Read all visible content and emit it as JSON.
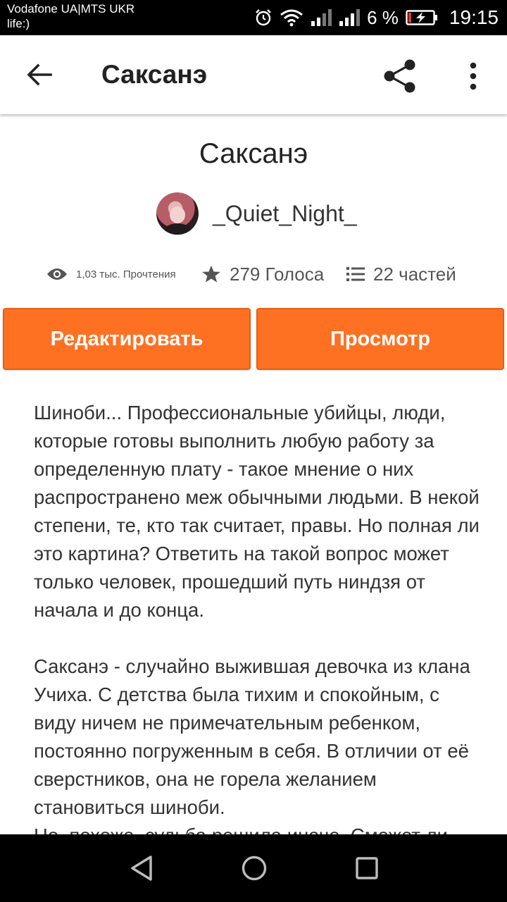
{
  "status_bar": {
    "carrier_line1": "Vodafone UA|MTS UKR",
    "carrier_line2": "life:)",
    "battery_percent": "6 %",
    "time": "19:15"
  },
  "app_bar": {
    "title": "Саксанэ",
    "icons": [
      "arrow-left-icon",
      "share-icon",
      "more-vert-icon"
    ]
  },
  "story": {
    "title": "Саксанэ",
    "author": "_Quiet_Night_",
    "reads_label": "1,03 тыс. Прочтения",
    "votes_label": "279 Голоса",
    "parts_label": "22 частей"
  },
  "buttons": {
    "edit_label": "Редактировать",
    "view_label": "Просмотр",
    "accent_color": "#fe7123"
  },
  "description": {
    "paragraph1": "Шиноби... Профессиональные убийцы, люди, которые готовы выполнить любую работу за определенную плату - такое мнение о них распространено меж обычными людьми. В некой степени, те, кто так считает, правы. Но полная ли это картина? Ответить на такой вопрос может только человек, прошедший путь ниндзя от начала и до конца.",
    "paragraph2": "Саксанэ - случайно выжившая девочка из клана Учиха. С детства была тихим и спокойным, с виду ничем не примечательным ребенком, постоянно погруженным в себя. В отличии от её сверстников, она не горела желанием становиться шиноби.",
    "paragraph3": "Но, похоже, судьба решила иначе. Сможет ли"
  },
  "nav_bar": {
    "icons": [
      "nav-back-icon",
      "nav-home-icon",
      "nav-recent-icon"
    ]
  }
}
